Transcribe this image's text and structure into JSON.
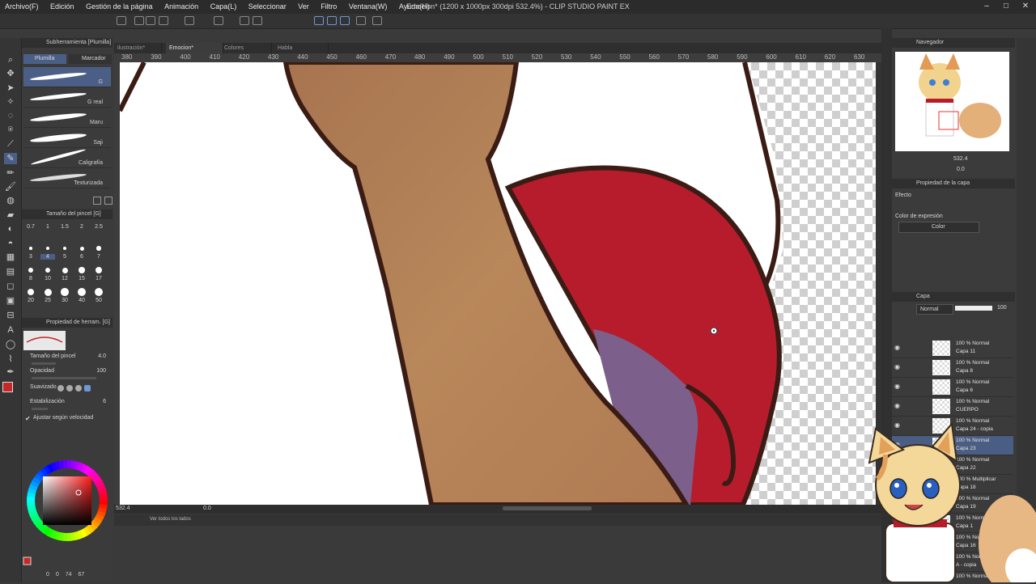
{
  "menu": [
    "Archivo(F)",
    "Edición",
    "Gestión de la página",
    "Animación",
    "Capa(L)",
    "Seleccionar",
    "Ver",
    "Filtro",
    "Ventana(W)",
    "Ayuda(H)"
  ],
  "window_title": "Emocion* (1200 x 1000px 300dpi 532.4%) - CLIP STUDIO PAINT EX",
  "subtool": {
    "title": "Subherramienta [Plumilla]",
    "tabs": [
      "Plumilla",
      "Marcador"
    ],
    "brushes": [
      "G",
      "G real",
      "Maru",
      "Saji",
      "Caligrafía",
      "Texturizada"
    ]
  },
  "brush_size": {
    "title": "Tamaño del pincel [G]",
    "sizes": [
      "0.7",
      "1",
      "1.5",
      "2",
      "2.5",
      "3",
      "4",
      "5",
      "6",
      "7",
      "8",
      "10",
      "12",
      "15",
      "17",
      "20",
      "25",
      "30",
      "40",
      "50"
    ]
  },
  "tool_property": {
    "title": "Propiedad de herram. [G]",
    "brush_size_label": "Tamaño del pincel",
    "brush_size_value": "4.0",
    "opacity_label": "Opacidad",
    "opacity_value": "100",
    "smoothing_label": "Suavizado",
    "stabilization_label": "Estabilización",
    "stabilization_value": "6",
    "speed_label": "Ajustar según velocidad"
  },
  "canvas_tabs": [
    "ilustración*",
    "Emocion*",
    "Colores",
    "Habla"
  ],
  "ruler_ticks": [
    "380",
    "390",
    "400",
    "410",
    "420",
    "430",
    "440",
    "450",
    "460",
    "470",
    "480",
    "490",
    "500",
    "510",
    "520",
    "530",
    "540",
    "550",
    "560",
    "570",
    "580",
    "590",
    "600",
    "610",
    "620",
    "630"
  ],
  "status": {
    "zoom": "532.4",
    "rotation": "0.0",
    "bottom_label": "Ver todos los lados"
  },
  "color_bottom": {
    "values": [
      "0",
      "0",
      "74",
      "67"
    ]
  },
  "navigator": {
    "title": "Navegador",
    "zoom": "532.4",
    "rotation": "0.0"
  },
  "layer_property": {
    "title": "Propiedad de la capa",
    "effect_label": "Efecto",
    "expression_label": "Color de expresión",
    "expression_value": "Color"
  },
  "layers": {
    "title": "Capa",
    "blend_mode": "Normal",
    "opacity": "100",
    "rows": [
      {
        "mode": "100 % Normal",
        "name": "Capa 11"
      },
      {
        "mode": "100 % Normal",
        "name": "Capa 8"
      },
      {
        "mode": "100 % Normal",
        "name": "Capa 6"
      },
      {
        "mode": "100 % Normal",
        "name": "CUERPO"
      },
      {
        "mode": "100 % Normal",
        "name": "Capa 24 - copia"
      },
      {
        "mode": "100 % Normal",
        "name": "Capa 23"
      },
      {
        "mode": "100 % Normal",
        "name": "Capa 22"
      },
      {
        "mode": "100 % Multiplicar",
        "name": "Capa 18"
      },
      {
        "mode": "100 % Normal",
        "name": "Capa 19"
      },
      {
        "mode": "100 % Normal",
        "name": "Capa 1"
      },
      {
        "mode": "100 % Normal",
        "name": "Capa 16"
      },
      {
        "mode": "100 % Normal",
        "name": "A - copia"
      },
      {
        "mode": "100 % Normal",
        "name": ""
      }
    ]
  },
  "colors": {
    "skin": "#b07e52",
    "cloth": "#b71c2c",
    "lining": "#7c5f8a",
    "outline": "#3a1c14",
    "selection": "#4a5d83",
    "main_color": "#c62828"
  }
}
